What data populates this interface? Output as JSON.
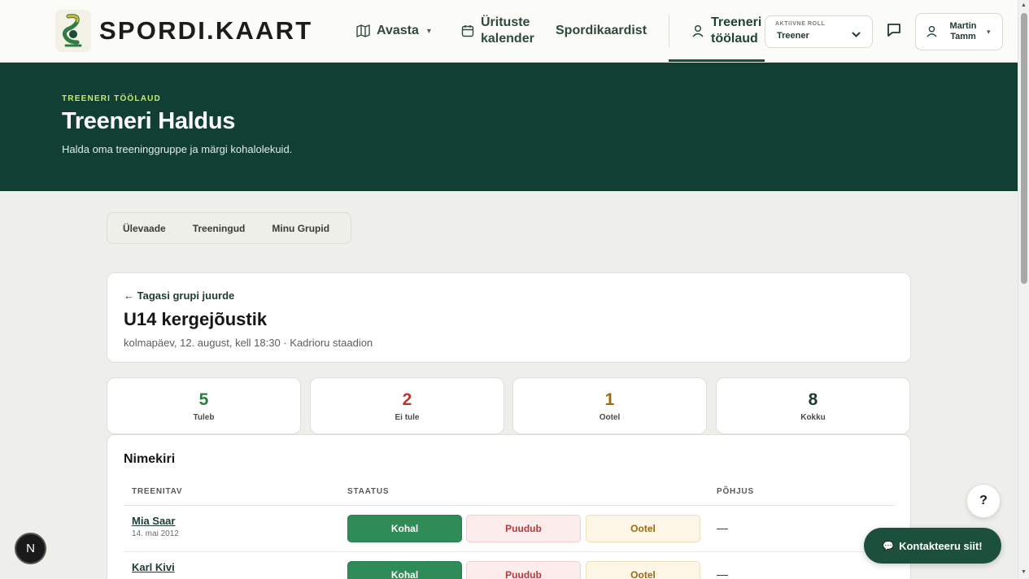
{
  "header": {
    "brand": "SPORDI.KAART",
    "nav": {
      "avasta": "Avasta",
      "kalender_line1": "Ürituste",
      "kalender_line2": "kalender",
      "spordikaardist": "Spordikaardist",
      "treener_line1": "Treeneri",
      "treener_line2": "töölaud"
    },
    "role": {
      "label": "AKTIIVNE ROLL",
      "value": "Treener"
    },
    "user": {
      "first": "Martin",
      "last": "Tamm"
    }
  },
  "hero": {
    "eyebrow": "TREENERI TÖÖLAUD",
    "title": "Treeneri Haldus",
    "subtitle": "Halda oma treeninggruppe ja märgi kohalolekuid."
  },
  "tabs": [
    "Ülevaade",
    "Treeningud",
    "Minu Grupid"
  ],
  "session": {
    "back": "← Tagasi grupi juurde",
    "title": "U14 kergejõustik",
    "meta": "kolmapäev, 12. august, kell 18:30 · Kadrioru staadion"
  },
  "stats": [
    {
      "value": "5",
      "label": "Tuleb",
      "color": "#2f7d45"
    },
    {
      "value": "2",
      "label": "Ei tule",
      "color": "#b8392f"
    },
    {
      "value": "1",
      "label": "Ootel",
      "color": "#9a6a12"
    },
    {
      "value": "8",
      "label": "Kokku",
      "color": "#183d30"
    }
  ],
  "roster": {
    "heading": "Nimekiri",
    "columns": {
      "trainee": "TREENITAV",
      "status": "STAATUS",
      "reason": "PÕHJUS"
    },
    "status_options": {
      "present": "Kohal",
      "absent": "Puudub",
      "pending": "Ootel"
    },
    "rows": [
      {
        "name": "Mia Saar",
        "dob": "14. mai 2012",
        "reason": "—"
      },
      {
        "name": "Karl Kivi",
        "dob": "",
        "reason": "—"
      }
    ]
  },
  "floating": {
    "help": "?",
    "contact": "Kontakteeru siit!",
    "next_badge": "N"
  }
}
